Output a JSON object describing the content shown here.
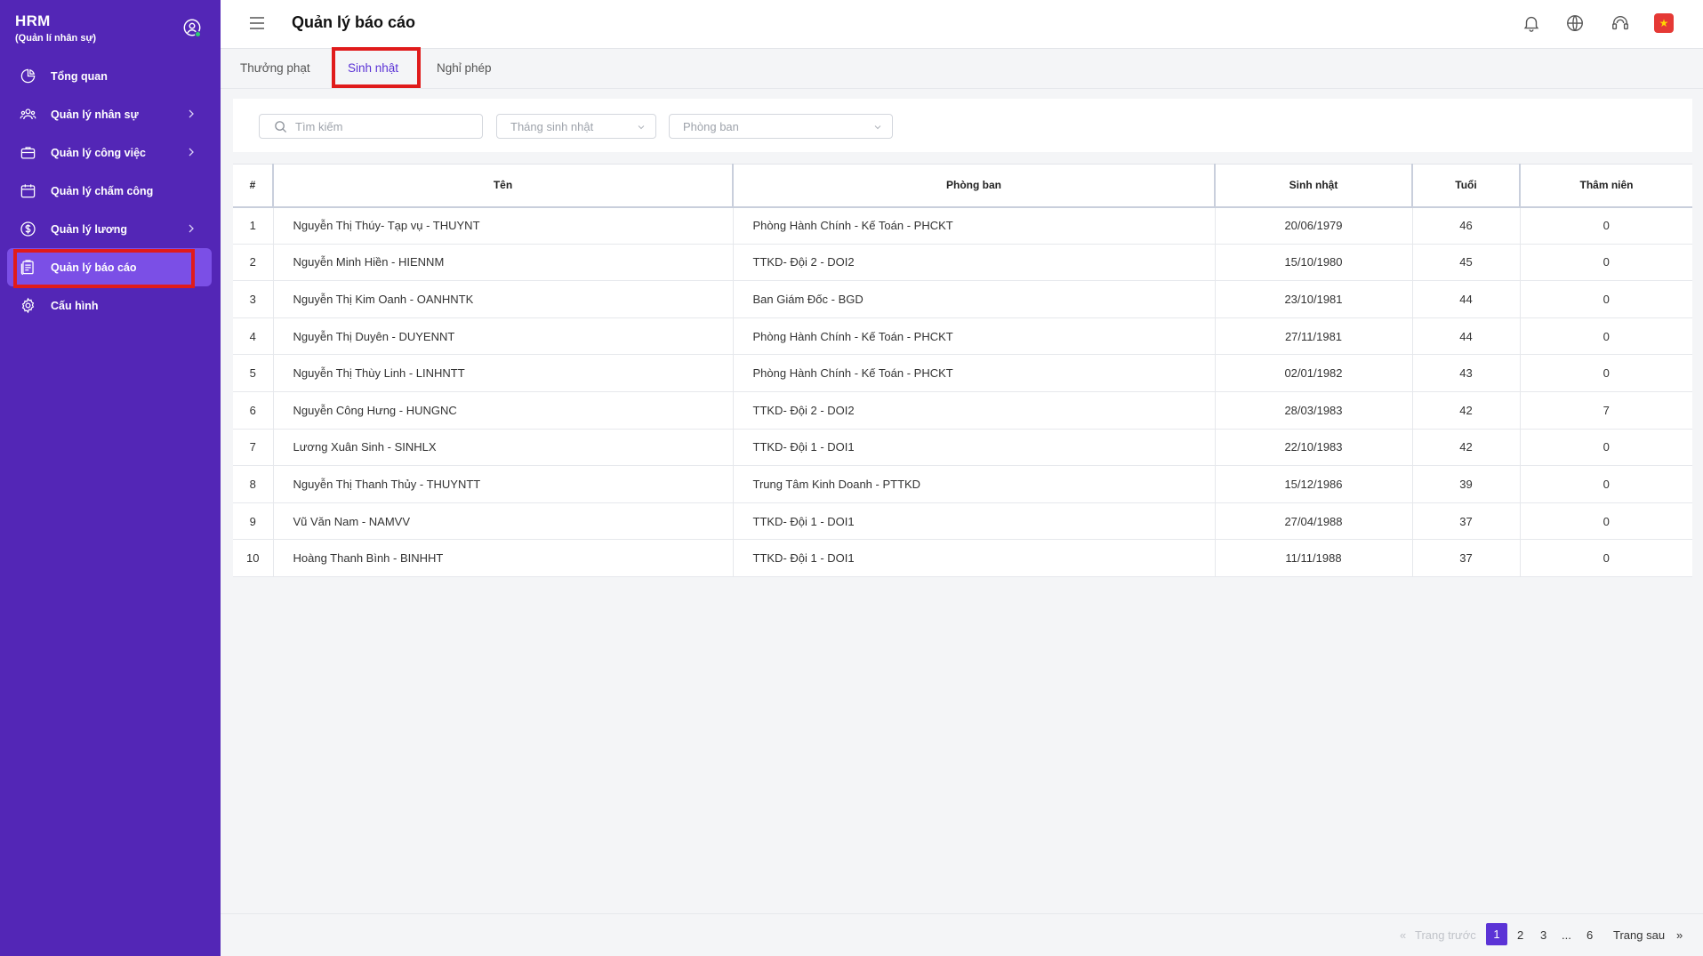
{
  "app": {
    "title": "HRM",
    "subtitle": "(Quản lí nhân sự)"
  },
  "sidebar": {
    "items": [
      {
        "label": "Tổng quan",
        "icon": "pie-chart-icon",
        "chevron": false
      },
      {
        "label": "Quản lý nhân sự",
        "icon": "users-icon",
        "chevron": true
      },
      {
        "label": "Quản lý công việc",
        "icon": "briefcase-icon",
        "chevron": true
      },
      {
        "label": "Quản lý chấm công",
        "icon": "calendar-icon",
        "chevron": false
      },
      {
        "label": "Quản lý lương",
        "icon": "dollar-icon",
        "chevron": true
      },
      {
        "label": "Quản lý báo cáo",
        "icon": "report-icon",
        "chevron": false,
        "active": true
      },
      {
        "label": "Cấu hình",
        "icon": "gear-icon",
        "chevron": false
      }
    ]
  },
  "header": {
    "title": "Quản lý báo cáo"
  },
  "tabs": [
    {
      "label": "Thưởng phạt"
    },
    {
      "label": "Sinh nhật",
      "active": true
    },
    {
      "label": "Nghỉ phép"
    }
  ],
  "filters": {
    "search_placeholder": "Tìm kiếm",
    "month_placeholder": "Tháng sinh nhật",
    "department_placeholder": "Phòng ban"
  },
  "table": {
    "headers": [
      "#",
      "Tên",
      "Phòng ban",
      "Sinh nhật",
      "Tuổi",
      "Thâm niên"
    ],
    "rows": [
      [
        "1",
        "Nguyễn Thị Thúy- Tạp vụ - THUYNT",
        "Phòng Hành Chính - Kế Toán - PHCKT",
        "20/06/1979",
        "46",
        "0"
      ],
      [
        "2",
        "Nguyễn Minh Hiền - HIENNM",
        "TTKD- Đội 2 - DOI2",
        "15/10/1980",
        "45",
        "0"
      ],
      [
        "3",
        "Nguyễn Thị Kim Oanh - OANHNTK",
        "Ban Giám Đốc - BGD",
        "23/10/1981",
        "44",
        "0"
      ],
      [
        "4",
        "Nguyễn Thị Duyên - DUYENNT",
        "Phòng Hành Chính - Kế Toán - PHCKT",
        "27/11/1981",
        "44",
        "0"
      ],
      [
        "5",
        "Nguyễn Thị Thùy Linh - LINHNTT",
        "Phòng Hành Chính - Kế Toán - PHCKT",
        "02/01/1982",
        "43",
        "0"
      ],
      [
        "6",
        "Nguyễn Công Hưng - HUNGNC",
        "TTKD- Đội 2 - DOI2",
        "28/03/1983",
        "42",
        "7"
      ],
      [
        "7",
        "Lương Xuân Sinh - SINHLX",
        "TTKD- Đội 1 - DOI1",
        "22/10/1983",
        "42",
        "0"
      ],
      [
        "8",
        "Nguyễn Thị Thanh Thủy - THUYNTT",
        "Trung Tâm Kinh Doanh - PTTKD",
        "15/12/1986",
        "39",
        "0"
      ],
      [
        "9",
        "Vũ Văn Nam - NAMVV",
        "TTKD- Đội 1 - DOI1",
        "27/04/1988",
        "37",
        "0"
      ],
      [
        "10",
        "Hoàng Thanh Bình - BINHHT",
        "TTKD- Đội 1 - DOI1",
        "11/11/1988",
        "37",
        "0"
      ]
    ]
  },
  "pagination": {
    "prev_symbol": "«",
    "prev_label": "Trang trước",
    "pages": [
      "1",
      "2",
      "3",
      "...",
      "6"
    ],
    "current": "1",
    "next_label": "Trang sau",
    "next_symbol": "»"
  },
  "colors": {
    "sidebar_bg": "#5326b6",
    "accent": "#5b33d6",
    "highlight": "#e01b1b"
  }
}
